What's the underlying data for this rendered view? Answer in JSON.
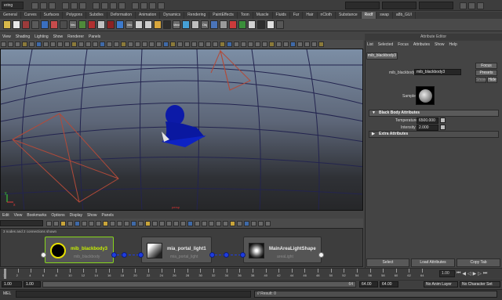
{
  "status_line": {
    "mode": "ering"
  },
  "shelf": {
    "tabs": [
      "General",
      "Curves",
      "Surfaces",
      "Polygons",
      "Subdivs",
      "Deformation",
      "Animation",
      "Dynamics",
      "Rendering",
      "PaintEffects",
      "Toon",
      "Muscle",
      "Fluids",
      "Fur",
      "Hair",
      "nCloth",
      "Substance",
      "Redf",
      "swap",
      "a8b_GUI"
    ],
    "active_tab": "Redf",
    "icon_labels": [
      "Vec",
      "Vec",
      "Med",
      "Obj"
    ]
  },
  "viewport": {
    "menu": [
      "View",
      "Shading",
      "Lighting",
      "Show",
      "Renderer",
      "Panels"
    ],
    "camera_label": "persp",
    "axis_y": "y",
    "axis_x": "x"
  },
  "node_editor": {
    "menu": [
      "Edit",
      "View",
      "Bookmarks",
      "Options",
      "Display",
      "Show",
      "Panels"
    ],
    "info": "3 nodes and 2 connections shown",
    "nodes": [
      {
        "name": "mib_blackbody3",
        "type": "mib_blackbody"
      },
      {
        "name": "mia_portal_light1",
        "type": "mia_portal_light"
      },
      {
        "name": "MainAreaLightShape",
        "type": "areaLight"
      }
    ]
  },
  "attribute_editor": {
    "title": "Attribute Editor",
    "menu": [
      "List",
      "Selected",
      "Focus",
      "Attributes",
      "Show",
      "Help"
    ],
    "tab": "mib_blackbody3",
    "node_label": "mib_blackbody:",
    "node_value": "mib_blackbody3",
    "focus_label": "Focus",
    "presets_label": "Presets",
    "show_label": "Show",
    "hide_label": "Hide",
    "sample_label": "Sample",
    "section_blackbody": "Black Body Attributes",
    "temperature_label": "Temperature",
    "temperature_value": "6500.000",
    "intensity_label": "Intensity",
    "intensity_value": "2.000",
    "section_extra": "Extra Attributes",
    "select_button": "Select",
    "load_button": "Load Attributes",
    "copy_button": "Copy Tab"
  },
  "timeline": {
    "ticks": [
      "1",
      "2",
      "4",
      "6",
      "8",
      "10",
      "12",
      "14",
      "16",
      "18",
      "20",
      "22",
      "24",
      "26",
      "28",
      "30",
      "32",
      "34",
      "36",
      "38",
      "40",
      "42",
      "44",
      "46",
      "48",
      "50",
      "52",
      "54",
      "56",
      "58",
      "60",
      "62",
      "64"
    ],
    "current_frame": "1.00"
  },
  "range": {
    "start": "1.00",
    "inner_start": "1.00",
    "inner_end": "64",
    "end_a": "64.00",
    "end_b": "64.00",
    "anim_layer": "No Anim Layer",
    "char_set": "No Character Set"
  },
  "command": {
    "mel_label": "MEL",
    "result": "// Result: 0"
  },
  "colors": {
    "accent_blue": "#1f3de0",
    "selected_node_green": "#c8f000"
  }
}
